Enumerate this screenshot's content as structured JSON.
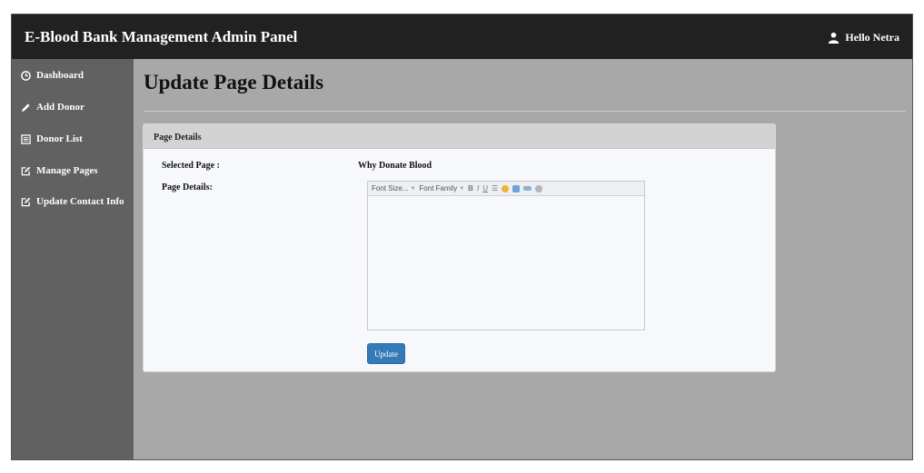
{
  "header": {
    "brand": "E-Blood Bank Management Admin Panel",
    "user_greeting": "Hello Netra"
  },
  "sidebar": {
    "items": [
      {
        "label": "Dashboard",
        "icon": "clock-icon"
      },
      {
        "label": "Add Donor",
        "icon": "pencil-icon"
      },
      {
        "label": "Donor List",
        "icon": "list-icon"
      },
      {
        "label": "Manage Pages",
        "icon": "edit-icon"
      },
      {
        "label": "Update Contact Info",
        "icon": "edit-icon"
      }
    ]
  },
  "main": {
    "title": "Update Page Details",
    "panel": {
      "heading": "Page Details",
      "selected_page_label": "Selected Page :",
      "selected_page_value": "Why Donate Blood",
      "page_details_label": "Page Details:",
      "editor": {
        "font_size_label": "Font Size...",
        "font_family_label": "Font Family",
        "bold": "B",
        "italic": "I",
        "underline": "U",
        "content": ""
      },
      "update_button": "Update"
    }
  },
  "colors": {
    "topbar": "#212121",
    "sidebar": "#616161",
    "content_bg": "#a8a8a8",
    "primary_button": "#337ab7"
  }
}
